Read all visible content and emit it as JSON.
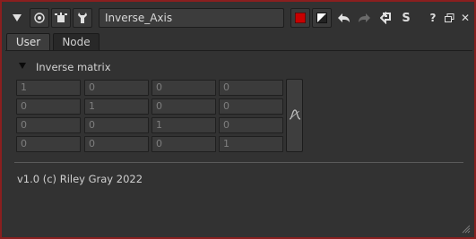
{
  "toolbar": {
    "node_name": "Inverse_Axis",
    "icons": [
      "collapse-icon",
      "center-node-icon",
      "settings-icon",
      "wrench-icon",
      "color-swatch-icon",
      "hide-icon",
      "undo-icon",
      "redo-icon",
      "revert-icon",
      "script-icon",
      "help-icon",
      "float-window-icon",
      "close-icon"
    ],
    "help_label": "?",
    "close_label": "✕",
    "script_label": "S",
    "accent_color": "#c80000"
  },
  "tabs": [
    {
      "label": "User",
      "active": true
    },
    {
      "label": "Node",
      "active": false
    }
  ],
  "section": {
    "label": "Inverse matrix"
  },
  "matrix": {
    "rows": [
      [
        "1",
        "0",
        "0",
        "0"
      ],
      [
        "0",
        "1",
        "0",
        "0"
      ],
      [
        "0",
        "0",
        "1",
        "0"
      ],
      [
        "0",
        "0",
        "0",
        "1"
      ]
    ],
    "anim_icon": "curve-icon"
  },
  "footer": {
    "credit": "v1.0 (c) Riley Gray 2022"
  }
}
